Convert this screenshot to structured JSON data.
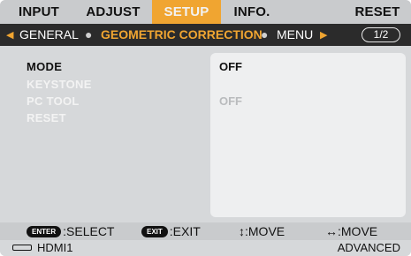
{
  "tabs": [
    {
      "label": "INPUT"
    },
    {
      "label": "ADJUST"
    },
    {
      "label": "SETUP"
    },
    {
      "label": "INFO."
    },
    {
      "label": "RESET"
    }
  ],
  "subbar": {
    "items": [
      "GENERAL",
      "GEOMETRIC CORRECTION",
      "MENU"
    ],
    "active_item": "GEOMETRIC CORRECTION",
    "page_indicator": "1/2"
  },
  "menu": {
    "rows": [
      {
        "label": "MODE",
        "value": "OFF",
        "enabled": true
      },
      {
        "label": "KEYSTONE",
        "value": "",
        "enabled": false
      },
      {
        "label": "PC TOOL",
        "value": "OFF",
        "enabled": false
      },
      {
        "label": "RESET",
        "value": "",
        "enabled": false
      }
    ]
  },
  "help": {
    "select_key": "ENTER",
    "select_label": ":SELECT",
    "exit_key": "EXIT",
    "exit_label": ":EXIT",
    "move_v": "↕:MOVE",
    "move_h": "↔:MOVE"
  },
  "status": {
    "source": "HDMI1",
    "mode": "ADVANCED"
  },
  "colors": {
    "accent": "#f0a531",
    "subbar_bg": "#2b2b2b",
    "panel_bg": "#d6d8da"
  }
}
